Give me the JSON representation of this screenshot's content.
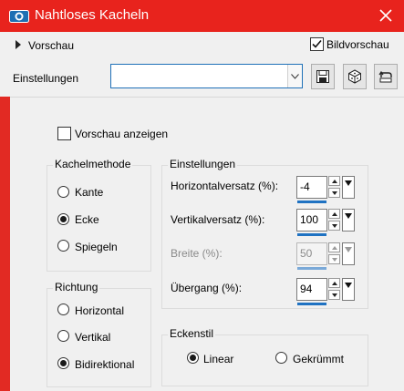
{
  "window": {
    "title": "Nahtloses Kacheln",
    "icon": "camera-icon",
    "accent": "#e8231d"
  },
  "preview": {
    "toggle_label": "Vorschau",
    "expanded": false,
    "bildvorschau_label": "Bildvorschau",
    "bildvorschau_checked": true
  },
  "settings_row": {
    "label": "Einstellungen",
    "combo_value": "",
    "buttons": [
      "save-preset-icon",
      "cube-icon",
      "reset-icon"
    ]
  },
  "show_preview": {
    "label": "Vorschau anzeigen",
    "checked": false
  },
  "tiling_method": {
    "title": "Kachelmethode",
    "options": [
      "Kante",
      "Ecke",
      "Spiegeln"
    ],
    "selected": "Ecke"
  },
  "direction": {
    "title": "Richtung",
    "options": [
      "Horizontal",
      "Vertikal",
      "Bidirektional"
    ],
    "selected": "Bidirektional"
  },
  "settings": {
    "title": "Einstellungen",
    "fields": [
      {
        "label": "Horizontalversatz (%):",
        "value": "-4",
        "enabled": true
      },
      {
        "label": "Vertikalversatz (%):",
        "value": "100",
        "enabled": true
      },
      {
        "label": "Breite (%):",
        "value": "50",
        "enabled": false
      },
      {
        "label": "Übergang (%):",
        "value": "94",
        "enabled": true
      }
    ]
  },
  "corner_style": {
    "title": "Eckenstil",
    "options": [
      "Linear",
      "Gekrümmt"
    ],
    "selected": "Linear"
  }
}
